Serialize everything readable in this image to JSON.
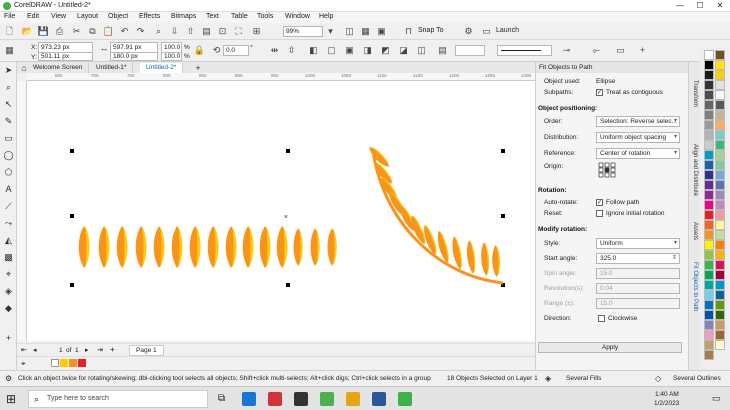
{
  "window": {
    "title": "CorelDRAW - Untitled-2*",
    "min": "—",
    "max": "☐",
    "close": "✕"
  },
  "menu": [
    "File",
    "Edit",
    "View",
    "Layout",
    "Object",
    "Effects",
    "Bitmaps",
    "Text",
    "Table",
    "Tools",
    "Window",
    "Help"
  ],
  "toolbar": {
    "zoom": "99%",
    "snap_to": "Snap To",
    "launch": "Launch"
  },
  "property_bar": {
    "x": "973.23 px",
    "y": "501.11 px",
    "w": "597.91 px",
    "h": "180.0 px",
    "scale_w": "100.0",
    "scale_h": "100.0",
    "pct1": "%",
    "pct2": "%",
    "x_label": "X:",
    "y_label": "Y:",
    "angle": "0.0",
    "degree": "°"
  },
  "tabs": [
    "Welcome Screen",
    "Untitled-1*",
    "Untitled-2*"
  ],
  "ruler_ticks": [
    "650",
    "700",
    "750",
    "800",
    "850",
    "900",
    "950",
    "1000",
    "1050",
    "1100",
    "1150",
    "1200",
    "1250",
    "1300"
  ],
  "page_nav": {
    "current": "1",
    "of": "of",
    "total": "1",
    "page_tab": "Page 1"
  },
  "docker": {
    "title": "Fit Objects to Path",
    "object_used_label": "Object used:",
    "object_used": "Ellipse",
    "subpaths_label": "Subpaths:",
    "subpaths_value": "Treat as contiguous",
    "positioning_header": "Object positioning:",
    "order_label": "Order:",
    "order": "Selection: Reverse selec...",
    "distribution_label": "Distribution:",
    "distribution": "Uniform object spacing",
    "reference_label": "Reference:",
    "reference": "Center of rotation",
    "origin_label": "Origin:",
    "rotation_header": "Rotation:",
    "autorotate_label": "Auto-rotate:",
    "autorotate_value": "Follow path",
    "reset_label": "Reset:",
    "reset_value": "Ignore initial rotation",
    "modify_header": "Modify rotation:",
    "style_label": "Style:",
    "style": "Uniform",
    "start_angle_label": "Start angle:",
    "start_angle": "325.0",
    "spin_label": "Spin angle:",
    "spin": "15.0",
    "revolution_label": "Revolution(s):",
    "revolution": "0.04",
    "range_label": "Range (±):",
    "range": "15.0",
    "direction_label": "Direction:",
    "direction_value": "Clockwise",
    "apply": "Apply"
  },
  "vertical_tabs": [
    "Transform",
    "Align and Distribute",
    "Assets",
    "Fit Objects to Path"
  ],
  "palette_colors": [
    "#ffffff",
    "#000000",
    "#1a1a1a",
    "#333333",
    "#4d4d4d",
    "#666666",
    "#808080",
    "#999999",
    "#b3b3b3",
    "#cccccc",
    "#00a0c6",
    "#1d5fa5",
    "#2e3192",
    "#662d91",
    "#92278f",
    "#ec008c",
    "#ed1c24",
    "#f26522",
    "#f7941d",
    "#fff200",
    "#8dc63f",
    "#39b54a",
    "#00a651",
    "#00a99d",
    "#6dcff6",
    "#0072bc",
    "#0054a6",
    "#8781bd",
    "#f49ac1",
    "#c69c6d",
    "#a67c52",
    "#754c24",
    "#ffe600",
    "#ffcd00",
    "#e2e2e2",
    "#f7f7f7",
    "#5b5b5b",
    "#c7b299",
    "#fbaf5d",
    "#7accc8",
    "#3cb878",
    "#a3d39c",
    "#82ca9c",
    "#7da7d9",
    "#5674b9",
    "#a186be",
    "#bd8cbf",
    "#f6989d",
    "#fff799",
    "#c4df9b",
    "#ff8000",
    "#ffb300",
    "#d4145a",
    "#9e0039",
    "#0099cc",
    "#006699",
    "#669900",
    "#336600",
    "#cc9966",
    "#996633",
    "#ffffcc"
  ],
  "status": {
    "hint": "Click an object twice for rotating/skewing; dbl-clicking tool selects all objects; Shift+click multi-selects; Alt+click digs; Ctrl+click selects in a group",
    "selection": "18 Objects Selected on Layer 1",
    "fill": "Several Fills",
    "outline": "Several Outlines"
  },
  "taskbar": {
    "search_placeholder": "Type here to search",
    "time": "1:40 AM",
    "date": "1/2/2023"
  },
  "colors": {
    "leaf_orange": "#f7941d",
    "leaf_yellow": "#ffcc00",
    "path_orange": "#f7941d",
    "accent_green": "#3cb34a"
  }
}
